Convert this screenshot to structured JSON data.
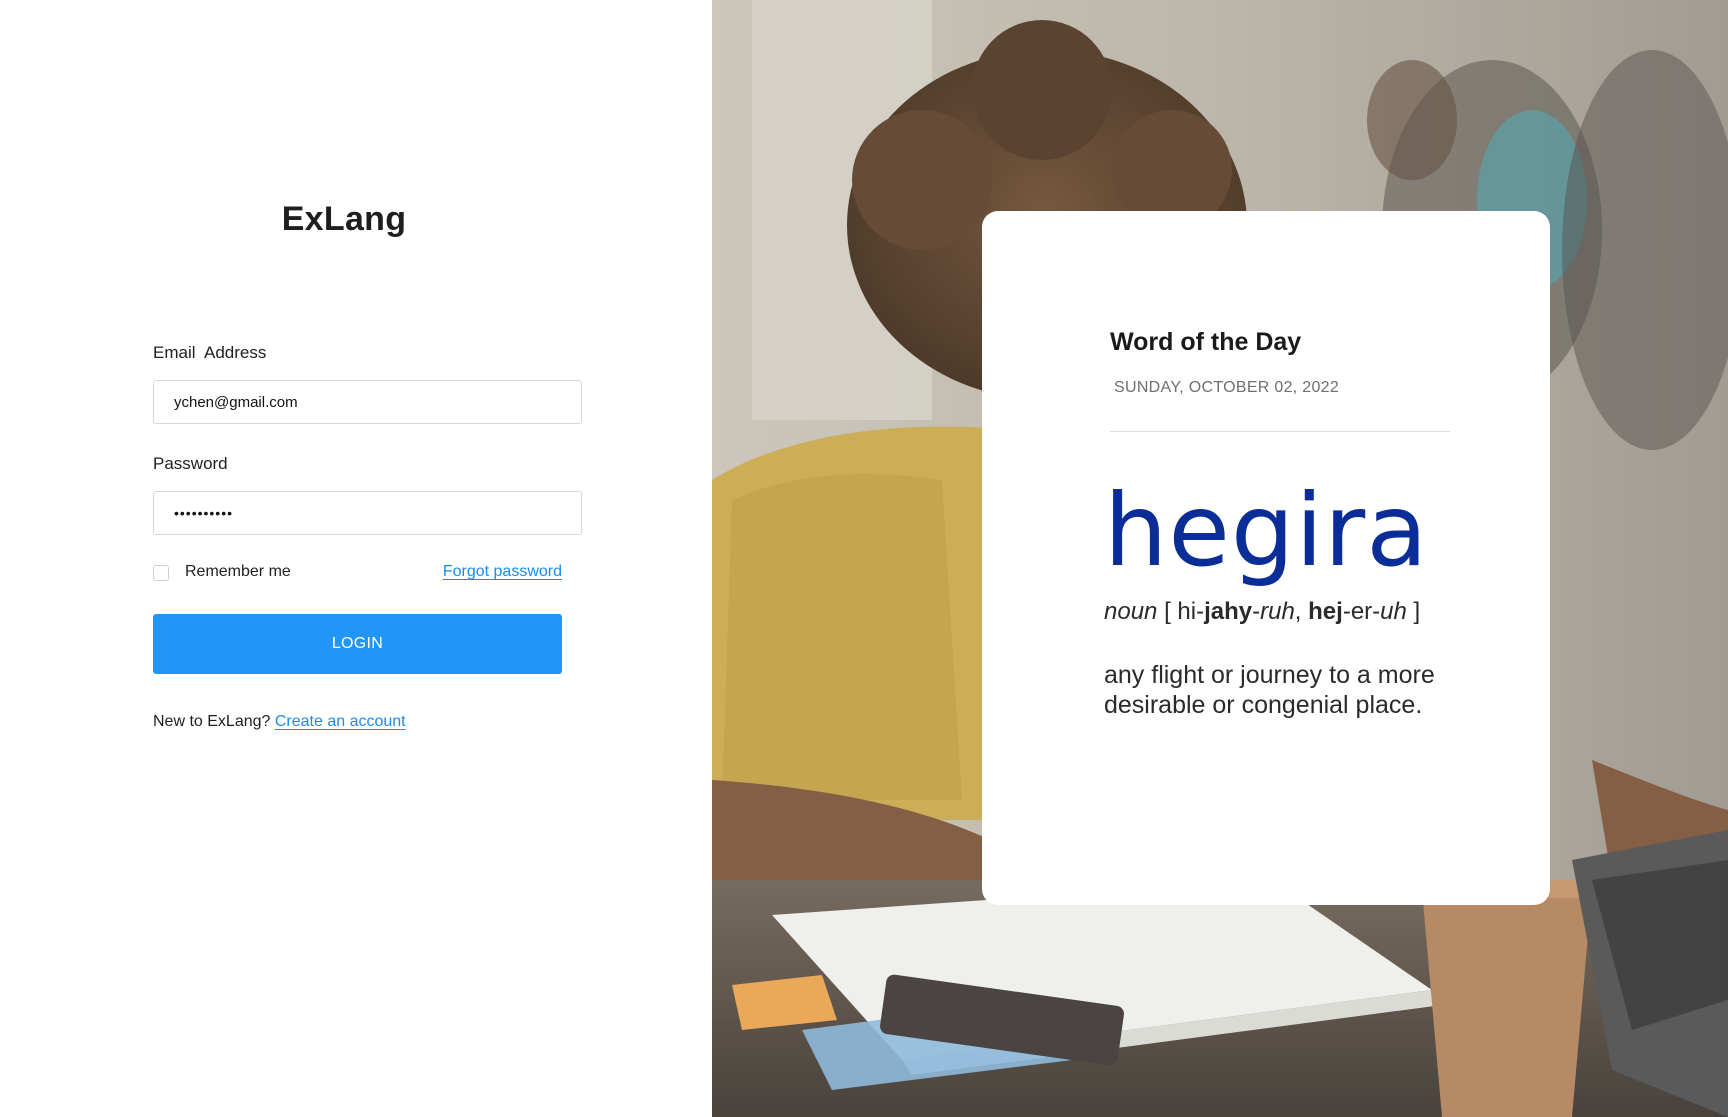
{
  "login": {
    "brand": "ExLang",
    "email_label": "Email  Address",
    "email_value": "ychen@gmail.com",
    "password_label": "Password",
    "password_value": "••••••••••",
    "remember_label": "Remember me",
    "forgot_label": "Forgot password",
    "login_label": "LOGIN",
    "signup_prompt": "New to ExLang?",
    "signup_link": "Create an account"
  },
  "word_of_the_day": {
    "heading": "Word of the Day",
    "date": "SUNDAY, OCTOBER 02, 2022",
    "word": "hegira",
    "pronunciation": {
      "part_of_speech": "noun",
      "open_bracket": "[",
      "p1_prefix": "hi-",
      "p1_stress": "jahy",
      "p1_mid": "-",
      "p1_suffix": "ruh",
      "separator": ",",
      "p2_stress": "hej",
      "p2_mid": "-er-",
      "p2_suffix": "uh",
      "close_bracket": "]"
    },
    "definition": "any flight or journey to a more desirable or congenial place."
  },
  "theme": {
    "accent": "#2196f8",
    "link": "#1a8cf0",
    "word_color": "#0b2d98"
  }
}
